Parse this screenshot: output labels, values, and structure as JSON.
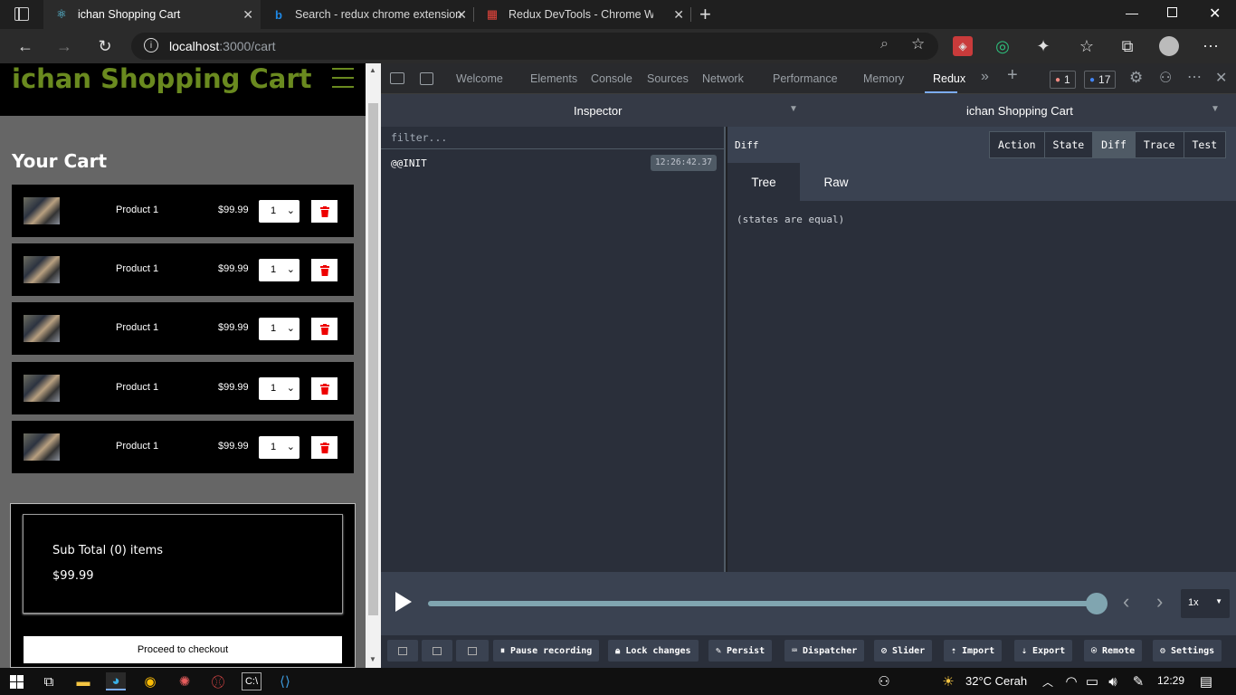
{
  "browser": {
    "tabs": [
      {
        "title": "ichan Shopping Cart",
        "active": true,
        "icon": "react-icon"
      },
      {
        "title": "Search - redux chrome extension",
        "active": false,
        "icon": "bing-icon"
      },
      {
        "title": "Redux DevTools - Chrome Web S",
        "active": false,
        "icon": "chrome-webstore-icon"
      }
    ],
    "url_host": "localhost",
    "url_rest": ":3000/cart"
  },
  "site": {
    "title": "ichan Shopping Cart",
    "cart_heading": "Your Cart",
    "items": [
      {
        "name": "Product 1",
        "price": "$99.99",
        "qty": "1"
      },
      {
        "name": "Product 1",
        "price": "$99.99",
        "qty": "1"
      },
      {
        "name": "Product 1",
        "price": "$99.99",
        "qty": "1"
      },
      {
        "name": "Product 1",
        "price": "$99.99",
        "qty": "1"
      },
      {
        "name": "Product 1",
        "price": "$99.99",
        "qty": "1"
      }
    ],
    "subtotal": "Sub Total (0) items",
    "subtotal_price": "$99.99",
    "checkout_label": "Proceed to checkout"
  },
  "devtools": {
    "tabs": [
      "Welcome",
      "Elements",
      "Console",
      "Sources",
      "Network",
      "Performance",
      "Memory",
      "Redux"
    ],
    "active_tab": "Redux",
    "errors": "1",
    "messages": "17",
    "inspector_label": "Inspector",
    "store_label": "ichan Shopping Cart",
    "filter_placeholder": "filter...",
    "action": {
      "name": "@@INIT",
      "time": "12:26:42.37"
    },
    "diff_label": "Diff",
    "view_buttons": [
      "Action",
      "State",
      "Diff",
      "Trace",
      "Test"
    ],
    "active_view": "Diff",
    "tree_tabs": [
      "Tree",
      "Raw"
    ],
    "states_equal": "(states are equal)",
    "speed": "1x",
    "bottom_buttons": [
      "Pause recording",
      "Lock changes",
      "Persist",
      "Dispatcher",
      "Slider",
      "Import",
      "Export",
      "Remote",
      "Settings"
    ]
  },
  "taskbar": {
    "weather": "32°C  Cerah",
    "time": "12:29"
  }
}
